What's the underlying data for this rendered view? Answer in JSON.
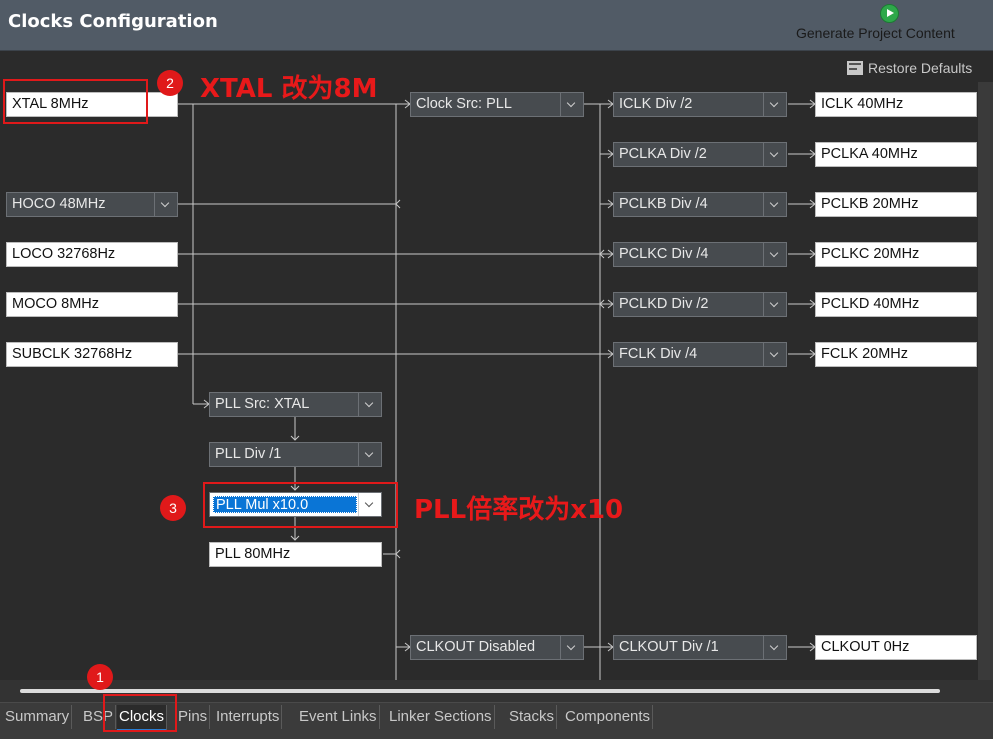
{
  "header": {
    "title": "Clocks Configuration",
    "generate_label": "Generate Project Content",
    "restore_label": "Restore Defaults"
  },
  "sources": {
    "xtal": "XTAL 8MHz",
    "hoco": "HOCO 48MHz",
    "loco": "LOCO 32768Hz",
    "moco": "MOCO 8MHz",
    "subclk": "SUBCLK 32768Hz"
  },
  "pll": {
    "src": "PLL Src: XTAL",
    "div": "PLL Div /1",
    "mul": "PLL Mul x10.0",
    "out": "PLL 80MHz"
  },
  "clock_src": "Clock Src: PLL",
  "clkout_src": "CLKOUT Disabled",
  "dividers": {
    "iclk": "ICLK Div /2",
    "pclka": "PCLKA Div /2",
    "pclkb": "PCLKB Div /4",
    "pclkc": "PCLKC Div /4",
    "pclkd": "PCLKD Div /2",
    "fclk": "FCLK Div /4",
    "clkout": "CLKOUT Div /1"
  },
  "outputs": {
    "iclk": "ICLK 40MHz",
    "pclka": "PCLKA 40MHz",
    "pclkb": "PCLKB 20MHz",
    "pclkc": "PCLKC 20MHz",
    "pclkd": "PCLKD 40MHz",
    "fclk": "FCLK 20MHz",
    "clkout": "CLKOUT 0Hz"
  },
  "annotations": {
    "badge1": "1",
    "badge2": "2",
    "badge3": "3",
    "xtal_note": "XTAL 改为8M",
    "pll_note": "PLL倍率改为x10"
  },
  "tabs": [
    "Summary",
    "BSP",
    "Clocks",
    "Pins",
    "Interrupts",
    "Event Links",
    "Linker Sections",
    "Stacks",
    "Components"
  ],
  "active_tab": "Clocks",
  "colors": {
    "annotation_red": "#e0191a",
    "selection_blue": "#0a75d6",
    "header_bg": "#515b66",
    "canvas_bg": "#2b2b2b"
  }
}
